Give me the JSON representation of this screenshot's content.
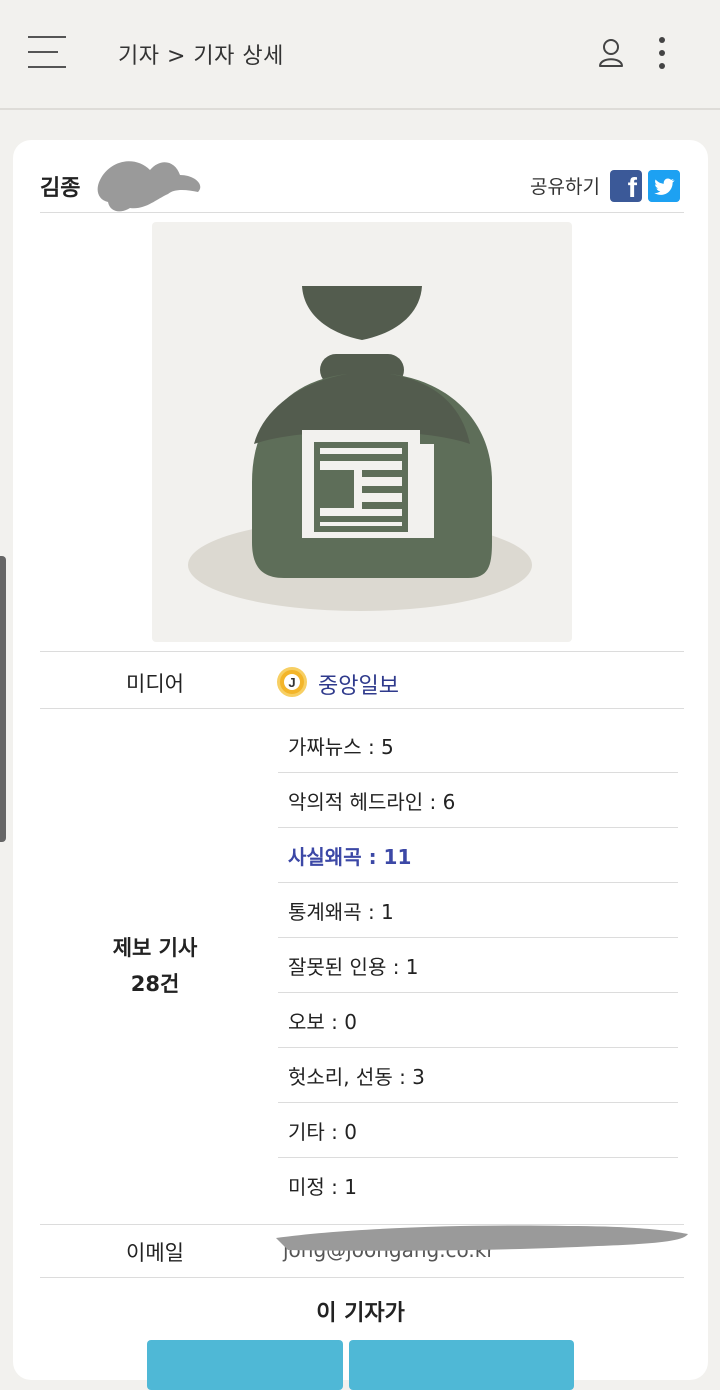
{
  "header": {
    "breadcrumb": "기자 > 기자 상세"
  },
  "profile": {
    "name": "김종",
    "share_label": "공유하기",
    "facebook_label": "f"
  },
  "media": {
    "label": "미디어",
    "logo_letter": "J",
    "name": "중앙일보"
  },
  "reports": {
    "label": "제보 기사",
    "total": "28건",
    "items": [
      {
        "text": "가짜뉴스 : 5",
        "active": false
      },
      {
        "text": "악의적 헤드라인 : 6",
        "active": false
      },
      {
        "text": "사실왜곡 : 11",
        "active": true
      },
      {
        "text": "통계왜곡 : 1",
        "active": false
      },
      {
        "text": "잘못된 인용 : 1",
        "active": false
      },
      {
        "text": "오보 : 0",
        "active": false
      },
      {
        "text": "헛소리, 선동 : 3",
        "active": false
      },
      {
        "text": "기타 : 0",
        "active": false
      },
      {
        "text": "미정 : 1",
        "active": false
      }
    ]
  },
  "email": {
    "label": "이메일",
    "value": "jong@joongang.co.kr"
  },
  "followup": {
    "title": "이 기자가"
  },
  "colors": {
    "accent": "#3c48a6",
    "media_link": "#2f3a8c",
    "button": "#4fb8d6",
    "bag": "#5e6e59",
    "bag_dark": "#535c4e"
  }
}
